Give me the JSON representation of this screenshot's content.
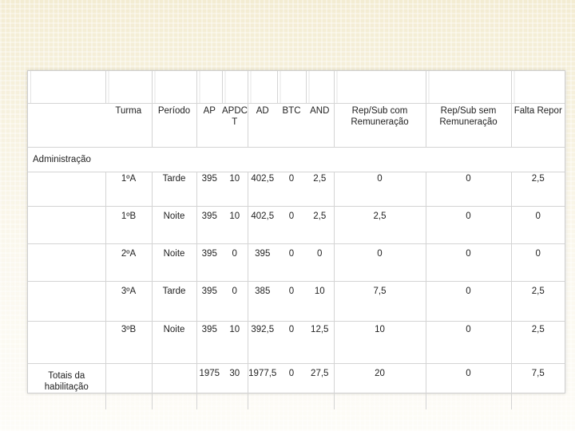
{
  "table": {
    "headers": [
      "Turma",
      "Período",
      "AP",
      "APDC T",
      "AD",
      "BTC",
      "AND",
      "Rep/Sub com Remuneração",
      "Rep/Sub sem Remuneração",
      "Falta Repor"
    ],
    "area_label": "Administração",
    "rows": [
      [
        "1ºA",
        "Tarde",
        "395",
        "10",
        "402,5",
        "0",
        "2,5",
        "0",
        "0",
        "2,5"
      ],
      [
        "1ºB",
        "Noite",
        "395",
        "10",
        "402,5",
        "0",
        "2,5",
        "2,5",
        "0",
        "0"
      ],
      [
        "2ºA",
        "Noite",
        "395",
        "0",
        "395",
        "0",
        "0",
        "0",
        "0",
        "0"
      ],
      [
        "3ºA",
        "Tarde",
        "395",
        "0",
        "385",
        "0",
        "10",
        "7,5",
        "0",
        "2,5"
      ],
      [
        "3ºB",
        "Noite",
        "395",
        "10",
        "392,5",
        "0",
        "12,5",
        "10",
        "0",
        "2,5"
      ]
    ],
    "totals_label": "Totais da habilitação",
    "totals": [
      "",
      "",
      "1975",
      "30",
      "1977,5",
      "0",
      "27,5",
      "20",
      "0",
      "7,5"
    ]
  }
}
